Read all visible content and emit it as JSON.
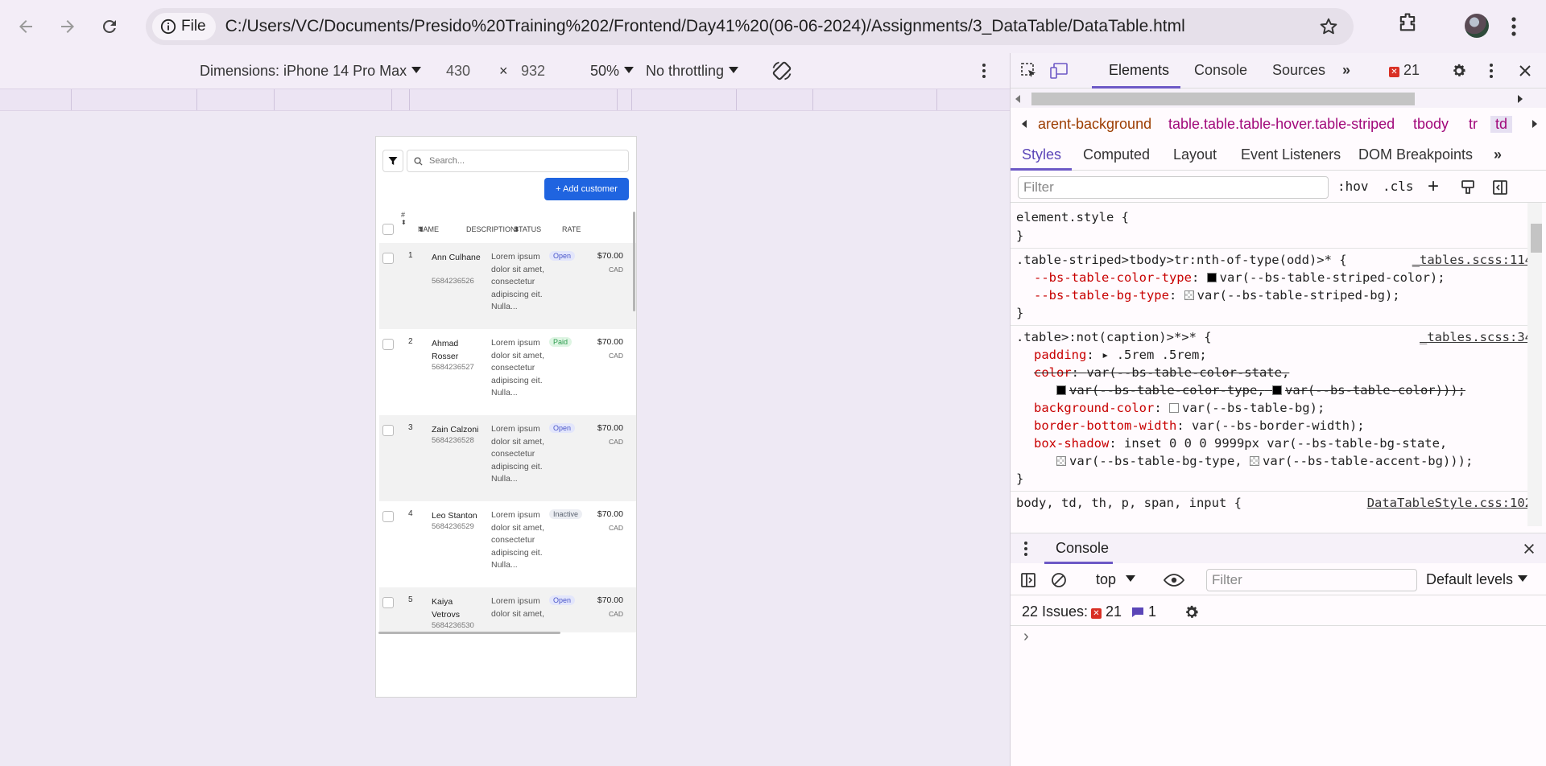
{
  "browser": {
    "chip_label": "File",
    "url": "C:/Users/VC/Documents/Presido%20Training%202/Frontend/Day41%20(06-06-2024)/Assignments/3_DataTable/DataTable.html"
  },
  "device_toolbar": {
    "dimensions_label": "Dimensions: iPhone 14 Pro Max",
    "width": "430",
    "times": "×",
    "height": "932",
    "zoom": "50%",
    "throttling": "No throttling"
  },
  "page": {
    "search_placeholder": "Search...",
    "add_customer_label": "+ Add customer",
    "table": {
      "headers": [
        "#",
        "NAME",
        "DESCRIPTION",
        "STATUS",
        "RATE"
      ],
      "rows": [
        {
          "num": "1",
          "name": "Ann Culhane",
          "phone": "5684236526",
          "description": "Lorem ipsum dolor sit amet, consectetur adipiscing eit. Nulla...",
          "status": "Open",
          "rate": "$70.00",
          "currency": "CAD"
        },
        {
          "num": "2",
          "name": "Ahmad Rosser",
          "phone": "5684236527",
          "description": "Lorem ipsum dolor sit amet, consectetur adipiscing eit. Nulla...",
          "status": "Paid",
          "rate": "$70.00",
          "currency": "CAD"
        },
        {
          "num": "3",
          "name": "Zain Calzoni",
          "phone": "5684236528",
          "description": "Lorem ipsum dolor sit amet, consectetur adipiscing eit. Nulla...",
          "status": "Open",
          "rate": "$70.00",
          "currency": "CAD"
        },
        {
          "num": "4",
          "name": "Leo Stanton",
          "phone": "5684236529",
          "description": "Lorem ipsum dolor sit amet, consectetur adipiscing eit. Nulla...",
          "status": "Inactive",
          "rate": "$70.00",
          "currency": "CAD"
        },
        {
          "num": "5",
          "name": "Kaiya Vetrovs",
          "phone": "5684236530",
          "description": "Lorem ipsum dolor sit amet,",
          "status": "Open",
          "rate": "$70.00",
          "currency": "CAD"
        }
      ]
    }
  },
  "devtools": {
    "tabs": [
      "Elements",
      "Console",
      "Sources"
    ],
    "error_count": "21",
    "breadcrumbs": [
      "arent-background",
      "table.table.table-hover.table-striped",
      "tbody",
      "tr",
      "td"
    ],
    "subtabs": [
      "Styles",
      "Computed",
      "Layout",
      "Event Listeners",
      "DOM Breakpoints"
    ],
    "filter_placeholder": "Filter",
    "hov": ":hov",
    "cls": ".cls",
    "styles": {
      "rule1_selector": "element.style {",
      "close": "}",
      "rule2_selector": ".table-striped>tbody>tr:nth-of-type(odd)>* {",
      "rule2_source": "_tables.scss:114",
      "rule2_p1_name": "--bs-table-color-type",
      "rule2_p1_val": "var(--bs-table-striped-color);",
      "rule2_p2_name": "--bs-table-bg-type",
      "rule2_p2_val": "var(--bs-table-striped-bg);",
      "rule3_selector": ".table>:not(caption)>*>* {",
      "rule3_source": "_tables.scss:34",
      "rule3_p1_name": "padding",
      "rule3_p1_val": ".5rem .5rem;",
      "rule3_p2_name": "color",
      "rule3_p2_val": "var(--bs-table-color-state,",
      "rule3_p2_cont_a": "var(--bs-table-color-type,",
      "rule3_p2_cont_b": "var(--bs-table-color)));",
      "rule3_p3_name": "background-color",
      "rule3_p3_val": "var(--bs-table-bg);",
      "rule3_p4_name": "border-bottom-width",
      "rule3_p4_val": "var(--bs-border-width);",
      "rule3_p5_name": "box-shadow",
      "rule3_p5_val": "inset 0 0 0 9999px var(--bs-table-bg-state,",
      "rule3_p5_cont_a": "var(--bs-table-bg-type,",
      "rule3_p5_cont_b": "var(--bs-table-accent-bg)));",
      "rule4_selector": "body, td, th, p, span, input {",
      "rule4_source": "DataTableStyle.css:102"
    },
    "console": {
      "tab_label": "Console",
      "context": "top",
      "filter_placeholder": "Filter",
      "levels": "Default levels",
      "issues_label": "22 Issues:",
      "issues_errors": "21",
      "issues_info": "1",
      "prompt": "›"
    }
  },
  "colors": {
    "accent": "#6d59c6",
    "add_button": "#1f64e0",
    "badge_open_bg": "#e3e6fb",
    "badge_open_fg": "#4a56c9",
    "badge_paid_bg": "#def5e3",
    "badge_paid_fg": "#2c9c4e",
    "badge_inactive_bg": "#eceef3",
    "badge_inactive_fg": "#5a6270"
  }
}
